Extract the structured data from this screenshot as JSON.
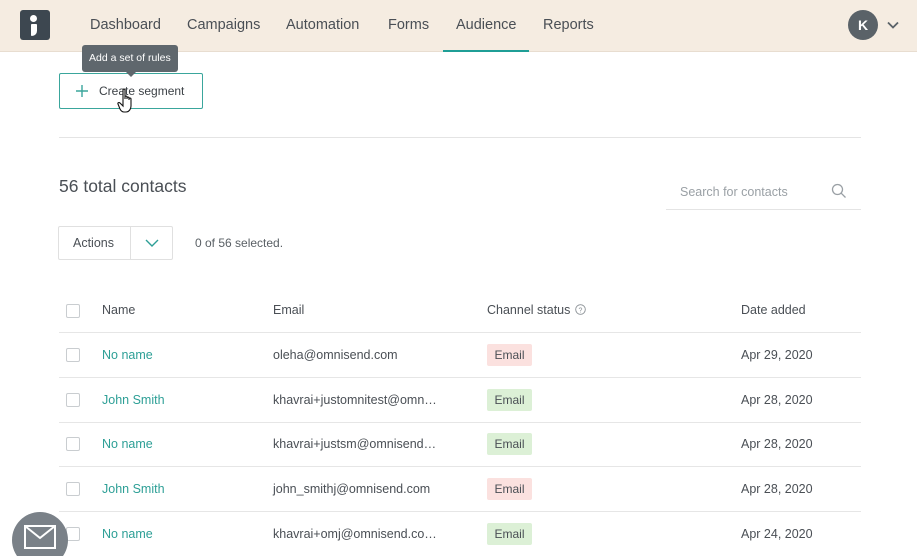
{
  "nav": {
    "items": [
      "Dashboard",
      "Campaigns",
      "Automation",
      "Forms",
      "Audience",
      "Reports"
    ],
    "active": "Audience",
    "avatar_initial": "K"
  },
  "tooltip": "Add a set of rules",
  "create_segment_label": "Create segment",
  "total_contacts": "56 total contacts",
  "search": {
    "placeholder": "Search for contacts"
  },
  "actions_label": "Actions",
  "selected_text": "0 of 56 selected.",
  "table": {
    "headers": {
      "name": "Name",
      "email": "Email",
      "channel_status": "Channel status",
      "date_added": "Date added"
    },
    "rows": [
      {
        "name": "No name",
        "email": "oleha@omnisend.com",
        "status": "Email",
        "status_color": "#fbe1df",
        "date": "Apr 29, 2020"
      },
      {
        "name": "John Smith",
        "email": "khavrai+justomnitest@omn…",
        "status": "Email",
        "status_color": "#dcf0d6",
        "date": "Apr 28, 2020"
      },
      {
        "name": "No name",
        "email": "khavrai+justsm@omnisend…",
        "status": "Email",
        "status_color": "#dcf0d6",
        "date": "Apr 28, 2020"
      },
      {
        "name": "John Smith",
        "email": "john_smithj@omnisend.com",
        "status": "Email",
        "status_color": "#fbe1df",
        "date": "Apr 28, 2020"
      },
      {
        "name": "No name",
        "email": "khavrai+omj@omnisend.co…",
        "status": "Email",
        "status_color": "#dcf0d6",
        "date": "Apr 24, 2020"
      }
    ]
  },
  "colors": {
    "accent": "#2d9f96",
    "nav_bg": "#f5ece1",
    "unsubscribed_badge": "#fbe1df",
    "subscribed_badge": "#dcf0d6"
  },
  "icons": [
    "logo-icon",
    "chevron-down-icon",
    "plus-icon",
    "hand-cursor-icon",
    "search-icon",
    "info-icon",
    "envelope-icon"
  ]
}
